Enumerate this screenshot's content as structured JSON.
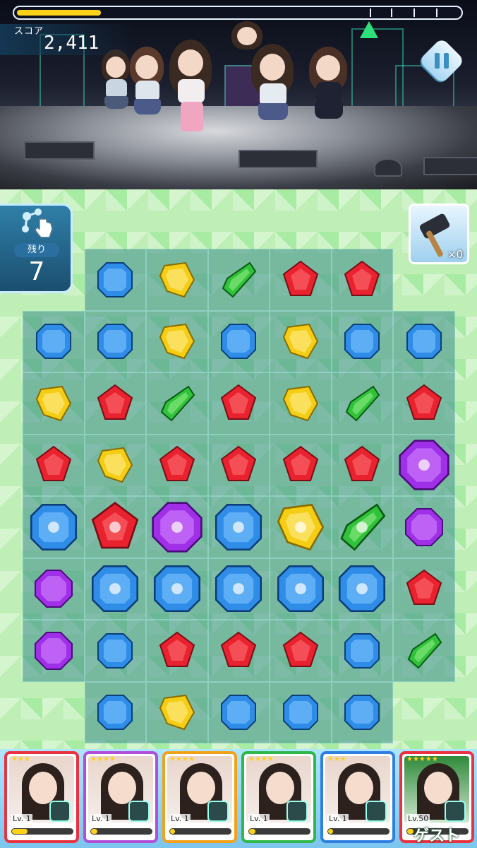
{
  "hud": {
    "score_label": "スコア",
    "score_value": "2,411",
    "progress": 0.19,
    "moves_label": "残り",
    "moves_value": "7",
    "hammer_count": "×0"
  },
  "colors": {
    "red": "#e8232f",
    "blue": "#2f8de8",
    "yellow": "#f5cd14",
    "green": "#2fc23a",
    "purple": "#a02fe8",
    "progress": "#ffd21a",
    "marker": "#2ee07a"
  },
  "board": {
    "rows": [
      [
        null,
        "blue",
        "yellow",
        "green",
        "red",
        "red",
        null
      ],
      [
        "blue",
        "blue",
        "yellow",
        "blue",
        "yellow",
        "blue",
        "blue"
      ],
      [
        "yellow",
        "red",
        "green",
        "red",
        "yellow",
        "green",
        "red"
      ],
      [
        "red",
        "yellow",
        "red",
        "red",
        "red",
        "red",
        "purple-special"
      ],
      [
        "blue-special",
        "red-special",
        "purple-special",
        "blue-special",
        "yellow-special",
        "green-special",
        "purple"
      ],
      [
        "purple",
        "blue-special",
        "blue-special",
        "blue-special",
        "blue-special",
        "blue-special",
        "red"
      ],
      [
        "purple",
        "blue",
        "red",
        "red",
        "red",
        "blue",
        "green"
      ],
      [
        null,
        "blue",
        "yellow",
        "blue",
        "blue",
        "blue",
        null
      ]
    ]
  },
  "cards": [
    {
      "stars": "★★★",
      "level": "Lv. 1",
      "border": "#e8323f",
      "gauge": 0.25
    },
    {
      "stars": "★★★★",
      "level": "Lv. 1",
      "border": "#b04fd8",
      "gauge": 0.1
    },
    {
      "stars": "★★★★",
      "level": "Lv. 1",
      "border": "#f2a21a",
      "gauge": 0.08
    },
    {
      "stars": "★★★★",
      "level": "Lv. 1",
      "border": "#2fb84a",
      "gauge": 0.1
    },
    {
      "stars": "★★★",
      "level": "Lv. 1",
      "border": "#2f7fe0",
      "gauge": 0.08
    },
    {
      "stars": "★★★★★",
      "level": "Lv.50",
      "border": "#e8323f",
      "gauge": 0.1,
      "label": "ゲスト"
    }
  ]
}
